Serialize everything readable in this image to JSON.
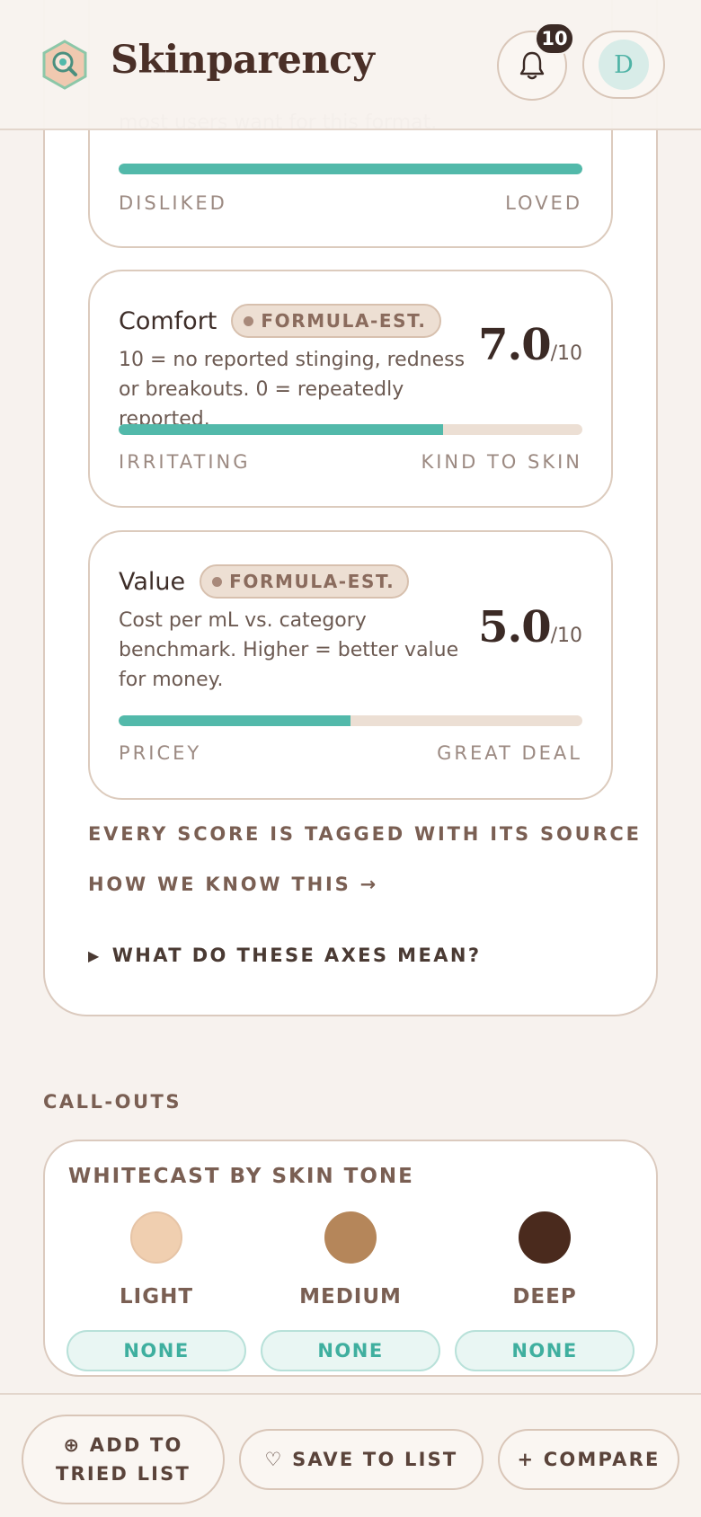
{
  "app": {
    "name": "Skinparency",
    "notifications_count": "10",
    "avatar_initial": "D"
  },
  "top_card": {
    "partial_description": "most users want for this format.",
    "bar_fraction": 1.0,
    "low_label": "DISLIKED",
    "high_label": "LOVED"
  },
  "comfort": {
    "title": "Comfort",
    "tag": "FORMULA-EST.",
    "description": "10 = no reported stinging, redness or breakouts. 0 = repeatedly reported.",
    "score": "7.0",
    "out_of": "/10",
    "bar_fraction": 0.7,
    "low_label": "IRRITATING",
    "high_label": "KIND TO SKIN"
  },
  "value": {
    "title": "Value",
    "tag": "FORMULA-EST.",
    "description": "Cost per mL vs. category benchmark. Higher = better value for money.",
    "score": "5.0",
    "out_of": "/10",
    "bar_fraction": 0.5,
    "low_label": "PRICEY",
    "high_label": "GREAT DEAL"
  },
  "source_note": "EVERY SCORE IS TAGGED WITH ITS SOURCE",
  "how_link": "HOW WE KNOW THIS →",
  "axes_toggle": "WHAT DO THESE AXES MEAN?",
  "callouts": {
    "heading": "CALL-OUTS",
    "whitecast": {
      "title": "WHITECAST BY SKIN TONE",
      "tones": [
        {
          "name": "LIGHT",
          "result": "NONE",
          "color": "#f0cfb0"
        },
        {
          "name": "MEDIUM",
          "result": "NONE",
          "color": "#b5865a"
        },
        {
          "name": "DEEP",
          "result": "NONE",
          "color": "#4a2a1d"
        }
      ]
    }
  },
  "bottom_bar": {
    "tried_label": "⊕ ADD TO TRIED LIST",
    "save_label": "♡ SAVE TO LIST",
    "compare_label": "+ COMPARE"
  },
  "colors": {
    "accent": "#52b9aa",
    "brand_text": "#4a2f27"
  }
}
